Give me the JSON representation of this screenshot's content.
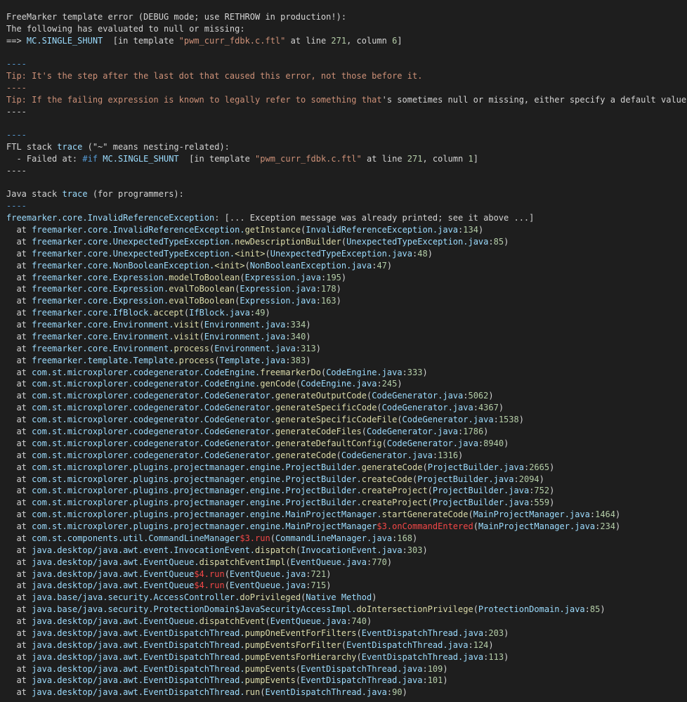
{
  "header": {
    "l1": "FreeMarker template error (DEBUG mode; use RETHROW in production!):",
    "l2": "The following has evaluated to null or missing:",
    "l3_prefix": "==> ",
    "l3_expr": "MC.SINGLE_SHUNT",
    "l3_mid": "  [in template ",
    "l3_tpl": "\"pwm_curr_fdbk.c.ftl\"",
    "l3_at": " at line ",
    "l3_line": "271",
    "l3_col": ", column ",
    "l3_colnum": "6",
    "l3_end": "]"
  },
  "sep": "----",
  "tip1": "Tip: It's the step after the last dot that caused this error, not those before it.",
  "tip2_a": "Tip: If the failing expression is known to legally refer to something that",
  "tip2_b": "'s sometimes null or missing, either specify a default value like myO",
  "ftl": {
    "l1_a": "FTL stack ",
    "l1_b": "trace",
    "l1_c": " (\"~\" means nesting-related):",
    "l2_a": "  - Failed at: ",
    "l2_b": "#if",
    "l2_c": " MC.SINGLE_SHUNT",
    "l2_d": "  [in template ",
    "l2_e": "\"pwm_curr_fdbk.c.ftl\"",
    "l2_f": " at line ",
    "l2_g": "271",
    "l2_h": ", column ",
    "l2_i": "1",
    "l2_j": "]"
  },
  "java": {
    "title_a": "Java stack ",
    "title_b": "trace",
    "title_c": " (for programmers):",
    "exc_a": "freemarker.core.InvalidReferenceException",
    "exc_b": ": [... Exception message was already printed; see it above ...]"
  },
  "at": "at",
  "frames": [
    {
      "pre": "freemarker.core.InvalidReferenceException.",
      "fn": "getInstance",
      "red": "",
      "fn2": "",
      "args": "InvalidReferenceException.java",
      "num": "134"
    },
    {
      "pre": "freemarker.core.UnexpectedTypeException.",
      "fn": "newDescriptionBuilder",
      "red": "",
      "fn2": "",
      "args": "UnexpectedTypeException.java",
      "num": "85"
    },
    {
      "pre": "freemarker.core.UnexpectedTypeException.",
      "fn": "<init>",
      "red": "",
      "fn2": "",
      "args": "UnexpectedTypeException.java",
      "num": "48"
    },
    {
      "pre": "freemarker.core.NonBooleanException.",
      "fn": "<init>",
      "red": "",
      "fn2": "",
      "args": "NonBooleanException.java",
      "num": "47"
    },
    {
      "pre": "freemarker.core.Expression.",
      "fn": "modelToBoolean",
      "red": "",
      "fn2": "",
      "args": "Expression.java",
      "num": "195"
    },
    {
      "pre": "freemarker.core.Expression.",
      "fn": "evalToBoolean",
      "red": "",
      "fn2": "",
      "args": "Expression.java",
      "num": "178"
    },
    {
      "pre": "freemarker.core.Expression.",
      "fn": "evalToBoolean",
      "red": "",
      "fn2": "",
      "args": "Expression.java",
      "num": "163"
    },
    {
      "pre": "freemarker.core.IfBlock.",
      "fn": "accept",
      "red": "",
      "fn2": "",
      "args": "IfBlock.java",
      "num": "49"
    },
    {
      "pre": "freemarker.core.Environment.",
      "fn": "visit",
      "red": "",
      "fn2": "",
      "args": "Environment.java",
      "num": "334"
    },
    {
      "pre": "freemarker.core.Environment.",
      "fn": "visit",
      "red": "",
      "fn2": "",
      "args": "Environment.java",
      "num": "340"
    },
    {
      "pre": "freemarker.core.Environment.",
      "fn": "process",
      "red": "",
      "fn2": "",
      "args": "Environment.java",
      "num": "313"
    },
    {
      "pre": "freemarker.template.Template.",
      "fn": "process",
      "red": "",
      "fn2": "",
      "args": "Template.java",
      "num": "383"
    },
    {
      "pre": "com.st.microxplorer.codegenerator.CodeEngine.",
      "fn": "freemarkerDo",
      "red": "",
      "fn2": "",
      "args": "CodeEngine.java",
      "num": "333"
    },
    {
      "pre": "com.st.microxplorer.codegenerator.CodeEngine.",
      "fn": "genCode",
      "red": "",
      "fn2": "",
      "args": "CodeEngine.java",
      "num": "245"
    },
    {
      "pre": "com.st.microxplorer.codegenerator.CodeGenerator.",
      "fn": "generateOutputCode",
      "red": "",
      "fn2": "",
      "args": "CodeGenerator.java",
      "num": "5062"
    },
    {
      "pre": "com.st.microxplorer.codegenerator.CodeGenerator.",
      "fn": "generateSpecificCode",
      "red": "",
      "fn2": "",
      "args": "CodeGenerator.java",
      "num": "4367"
    },
    {
      "pre": "com.st.microxplorer.codegenerator.CodeGenerator.",
      "fn": "generateSpecificCodeFile",
      "red": "",
      "fn2": "",
      "args": "CodeGenerator.java",
      "num": "1538"
    },
    {
      "pre": "com.st.microxplorer.codegenerator.CodeGenerator.",
      "fn": "generateCodeFiles",
      "red": "",
      "fn2": "",
      "args": "CodeGenerator.java",
      "num": "1786"
    },
    {
      "pre": "com.st.microxplorer.codegenerator.CodeGenerator.",
      "fn": "generateDefaultConfig",
      "red": "",
      "fn2": "",
      "args": "CodeGenerator.java",
      "num": "8940"
    },
    {
      "pre": "com.st.microxplorer.codegenerator.CodeGenerator.",
      "fn": "generateCode",
      "red": "",
      "fn2": "",
      "args": "CodeGenerator.java",
      "num": "1316"
    },
    {
      "pre": "com.st.microxplorer.plugins.projectmanager.engine.ProjectBuilder.",
      "fn": "generateCode",
      "red": "",
      "fn2": "",
      "args": "ProjectBuilder.java",
      "num": "2665"
    },
    {
      "pre": "com.st.microxplorer.plugins.projectmanager.engine.ProjectBuilder.",
      "fn": "createCode",
      "red": "",
      "fn2": "",
      "args": "ProjectBuilder.java",
      "num": "2094"
    },
    {
      "pre": "com.st.microxplorer.plugins.projectmanager.engine.ProjectBuilder.",
      "fn": "createProject",
      "red": "",
      "fn2": "",
      "args": "ProjectBuilder.java",
      "num": "752"
    },
    {
      "pre": "com.st.microxplorer.plugins.projectmanager.engine.ProjectBuilder.",
      "fn": "createProject",
      "red": "",
      "fn2": "",
      "args": "ProjectBuilder.java",
      "num": "559"
    },
    {
      "pre": "com.st.microxplorer.plugins.projectmanager.engine.MainProjectManager.",
      "fn": "startGenerateCode",
      "red": "",
      "fn2": "",
      "args": "MainProjectManager.java",
      "num": "1464"
    },
    {
      "pre": "com.st.microxplorer.plugins.projectmanager.engine.MainProjectManager",
      "fn": "",
      "red": "$3.onCommandEntered",
      "fn2": "",
      "args": "MainProjectManager.java",
      "num": "234"
    },
    {
      "pre": "com.st.components.util.CommandLineManager",
      "fn": "",
      "red": "$3.run",
      "fn2": "",
      "args": "CommandLineManager.java",
      "num": "168"
    },
    {
      "pre": "java.desktop/java.awt.event.InvocationEvent.",
      "fn": "dispatch",
      "red": "",
      "fn2": "",
      "args": "InvocationEvent.java",
      "num": "303"
    },
    {
      "pre": "java.desktop/java.awt.EventQueue.",
      "fn": "dispatchEventImpl",
      "red": "",
      "fn2": "",
      "args": "EventQueue.java",
      "num": "770"
    },
    {
      "pre": "java.desktop/java.awt.EventQueue",
      "fn": "",
      "red": "$4.run",
      "fn2": "",
      "args": "EventQueue.java",
      "num": "721"
    },
    {
      "pre": "java.desktop/java.awt.EventQueue",
      "fn": "",
      "red": "$4.run",
      "fn2": "",
      "args": "EventQueue.java",
      "num": "715"
    },
    {
      "pre": "java.base/java.security.AccessController.",
      "fn": "doPrivileged",
      "red": "",
      "fn2": "",
      "args": "Native Method",
      "num": ""
    },
    {
      "pre": "java.base/java.security.ProtectionDomain$JavaSecurityAccessImpl.",
      "fn": "doIntersectionPrivilege",
      "red": "",
      "fn2": "",
      "args": "ProtectionDomain.java",
      "num": "85"
    },
    {
      "pre": "java.desktop/java.awt.EventQueue.",
      "fn": "dispatchEvent",
      "red": "",
      "fn2": "",
      "args": "EventQueue.java",
      "num": "740"
    },
    {
      "pre": "java.desktop/java.awt.EventDispatchThread.",
      "fn": "pumpOneEventForFilters",
      "red": "",
      "fn2": "",
      "args": "EventDispatchThread.java",
      "num": "203"
    },
    {
      "pre": "java.desktop/java.awt.EventDispatchThread.",
      "fn": "pumpEventsForFilter",
      "red": "",
      "fn2": "",
      "args": "EventDispatchThread.java",
      "num": "124"
    },
    {
      "pre": "java.desktop/java.awt.EventDispatchThread.",
      "fn": "pumpEventsForHierarchy",
      "red": "",
      "fn2": "",
      "args": "EventDispatchThread.java",
      "num": "113"
    },
    {
      "pre": "java.desktop/java.awt.EventDispatchThread.",
      "fn": "pumpEvents",
      "red": "",
      "fn2": "",
      "args": "EventDispatchThread.java",
      "num": "109"
    },
    {
      "pre": "java.desktop/java.awt.EventDispatchThread.",
      "fn": "pumpEvents",
      "red": "",
      "fn2": "",
      "args": "EventDispatchThread.java",
      "num": "101"
    },
    {
      "pre": "java.desktop/java.awt.EventDispatchThread.",
      "fn": "run",
      "red": "",
      "fn2": "",
      "args": "EventDispatchThread.java",
      "num": "90"
    }
  ]
}
